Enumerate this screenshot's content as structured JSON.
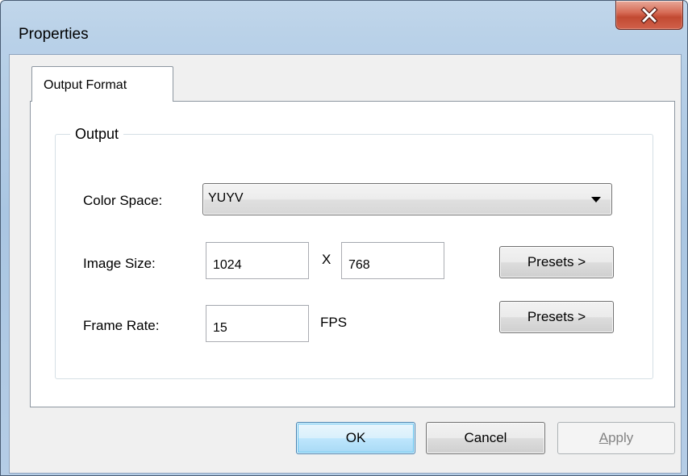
{
  "window": {
    "title": "Properties",
    "close_glyph": "x",
    "close_icon": "close-icon"
  },
  "tabs": [
    {
      "label": "Output Format",
      "selected": true
    }
  ],
  "group": {
    "legend": "Output"
  },
  "color_space": {
    "label": "Color Space:",
    "selected": "YUYV",
    "arrow_icon": "chevron-down-icon"
  },
  "image_size": {
    "label": "Image Size:",
    "width": "1024",
    "separator": "X",
    "height": "768",
    "presets_label": "Presets >"
  },
  "frame_rate": {
    "label": "Frame Rate:",
    "value": "15",
    "unit": "FPS",
    "presets_label": "Presets >"
  },
  "footer": {
    "ok_label": "OK",
    "cancel_label": "Cancel",
    "apply_mnemonic": "A",
    "apply_rest": "pply",
    "apply_enabled": false
  },
  "colors": {
    "title_bar": "#b9d1e8",
    "close_button": "#c24a32",
    "client_bg": "#f0f0f0",
    "default_button_border": "#3c7fb1"
  }
}
